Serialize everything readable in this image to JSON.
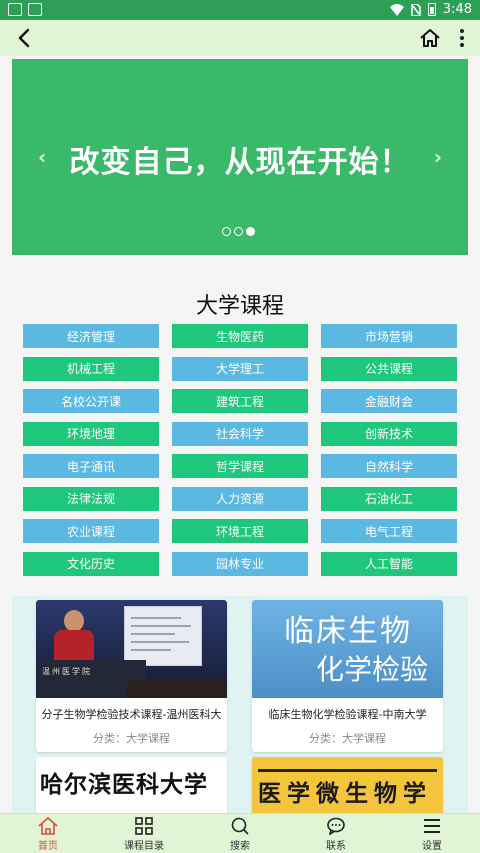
{
  "status_bar": {
    "time": "3:48"
  },
  "toolbar": {},
  "banner": {
    "text": "改变自己，从现在开始！",
    "prev": "‹",
    "next": "›",
    "active_dot": 2
  },
  "section": {
    "title": "大学课程"
  },
  "categories": [
    {
      "label": "经济管理",
      "color": "blue"
    },
    {
      "label": "生物医药",
      "color": "green"
    },
    {
      "label": "市场营销",
      "color": "blue"
    },
    {
      "label": "机械工程",
      "color": "green"
    },
    {
      "label": "大学理工",
      "color": "blue"
    },
    {
      "label": "公共课程",
      "color": "green"
    },
    {
      "label": "名校公开课",
      "color": "blue"
    },
    {
      "label": "建筑工程",
      "color": "green"
    },
    {
      "label": "金融财会",
      "color": "blue"
    },
    {
      "label": "环境地理",
      "color": "green"
    },
    {
      "label": "社会科学",
      "color": "blue"
    },
    {
      "label": "创新技术",
      "color": "green"
    },
    {
      "label": "电子通讯",
      "color": "blue"
    },
    {
      "label": "哲学课程",
      "color": "green"
    },
    {
      "label": "自然科学",
      "color": "blue"
    },
    {
      "label": "法律法规",
      "color": "green"
    },
    {
      "label": "人力资源",
      "color": "blue"
    },
    {
      "label": "石油化工",
      "color": "green"
    },
    {
      "label": "农业课程",
      "color": "blue"
    },
    {
      "label": "环境工程",
      "color": "green"
    },
    {
      "label": "电气工程",
      "color": "blue"
    },
    {
      "label": "文化历史",
      "color": "green"
    },
    {
      "label": "园林专业",
      "color": "blue"
    },
    {
      "label": "人工智能",
      "color": "green"
    }
  ],
  "courses": [
    {
      "title": "分子生物学检验技术课程-温州医科大",
      "meta": "分类：大学课程",
      "thumb_label": "温州医学院"
    },
    {
      "title": "临床生物化学检验课程-中南大学",
      "meta": "分类：大学课程",
      "thumb_line1": "临床生物",
      "thumb_line2": "化学检验"
    },
    {
      "title": "哈尔滨医科大学"
    },
    {
      "title": "医学微生物学"
    }
  ],
  "tabs": [
    {
      "label": "首页",
      "icon": "home-icon",
      "active": true
    },
    {
      "label": "课程目录",
      "icon": "qr-grid-icon",
      "active": false
    },
    {
      "label": "搜索",
      "icon": "search-icon",
      "active": false
    },
    {
      "label": "联系",
      "icon": "chat-icon",
      "active": false
    },
    {
      "label": "设置",
      "icon": "menu-icon",
      "active": false
    }
  ],
  "colors": {
    "status_bar": "#2f9e57",
    "toolbar": "#dff5d6",
    "banner": "#3bb96a",
    "category_blue": "#5bb8e0",
    "category_green": "#1fc77d",
    "tab_active": "#e24b3b"
  }
}
